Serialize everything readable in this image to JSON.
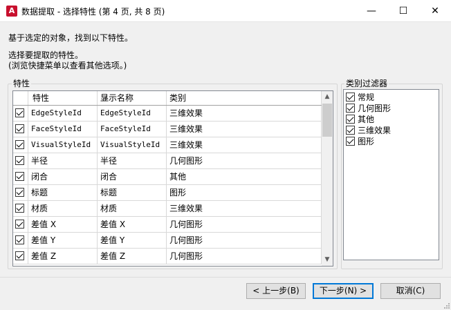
{
  "window": {
    "app_icon_letter": "A",
    "title": "数据提取 - 选择特性 (第 4 页, 共 8 页)",
    "minimize": "—",
    "maximize": "☐",
    "close": "✕"
  },
  "description": {
    "line1": "基于选定的对象，找到以下特性。",
    "line2": "选择要提取的特性。",
    "line3": "(浏览快捷菜单以查看其他选项。)"
  },
  "properties": {
    "group_label": "特性",
    "columns": [
      "特性",
      "显示名称",
      "类别"
    ],
    "rows": [
      {
        "checked": true,
        "property": "EdgeStyleId",
        "display": "EdgeStyleId",
        "category": "三维效果"
      },
      {
        "checked": true,
        "property": "FaceStyleId",
        "display": "FaceStyleId",
        "category": "三维效果"
      },
      {
        "checked": true,
        "property": "VisualStyleId",
        "display": "VisualStyleId",
        "category": "三维效果"
      },
      {
        "checked": true,
        "property": "半径",
        "display": "半径",
        "category": "几何图形"
      },
      {
        "checked": true,
        "property": "闭合",
        "display": "闭合",
        "category": "其他"
      },
      {
        "checked": true,
        "property": "标题",
        "display": "标题",
        "category": "图形"
      },
      {
        "checked": true,
        "property": "材质",
        "display": "材质",
        "category": "三维效果"
      },
      {
        "checked": true,
        "property": "差值 X",
        "display": "差值 X",
        "category": "几何图形"
      },
      {
        "checked": true,
        "property": "差值 Y",
        "display": "差值 Y",
        "category": "几何图形"
      },
      {
        "checked": true,
        "property": "差值 Z",
        "display": "差值 Z",
        "category": "几何图形"
      }
    ]
  },
  "filter": {
    "group_label": "类别过滤器",
    "items": [
      {
        "checked": true,
        "label": "常规"
      },
      {
        "checked": true,
        "label": "几何图形"
      },
      {
        "checked": true,
        "label": "其他"
      },
      {
        "checked": true,
        "label": "三维效果"
      },
      {
        "checked": true,
        "label": "图形"
      }
    ]
  },
  "buttons": {
    "back": "< 上一步(B)",
    "next": "下一步(N) >",
    "cancel": "取消(C)"
  }
}
